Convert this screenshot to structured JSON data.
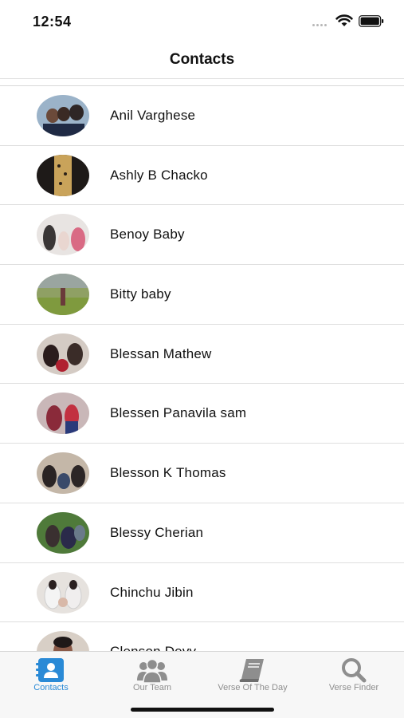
{
  "status_bar": {
    "time": "12:54"
  },
  "nav": {
    "title": "Contacts"
  },
  "contacts": [
    {
      "name": "Anil Varghese"
    },
    {
      "name": "Ashly B Chacko"
    },
    {
      "name": "Benoy Baby"
    },
    {
      "name": "Bitty baby"
    },
    {
      "name": "Blessan Mathew"
    },
    {
      "name": "Blessen Panavila sam"
    },
    {
      "name": "Blesson K Thomas"
    },
    {
      "name": "Blessy Cherian"
    },
    {
      "name": "Chinchu Jibin"
    },
    {
      "name": "Clenson Devy"
    }
  ],
  "tabs": [
    {
      "label": "Contacts",
      "icon": "contact-book-icon",
      "active": true
    },
    {
      "label": "Our Team",
      "icon": "group-icon",
      "active": false
    },
    {
      "label": "Verse Of The Day",
      "icon": "book-icon",
      "active": false
    },
    {
      "label": "Verse Finder",
      "icon": "search-icon",
      "active": false
    }
  ],
  "colors": {
    "accent": "#2a8ad6",
    "inactive": "#8e8e8e",
    "tab_bar_bg": "#f7f7f7"
  }
}
